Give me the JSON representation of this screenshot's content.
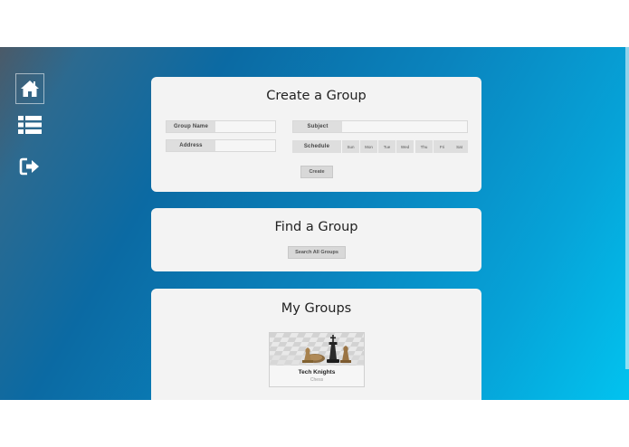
{
  "nav": {
    "items": [
      {
        "name": "home",
        "icon": "home-icon",
        "active": true
      },
      {
        "name": "list",
        "icon": "list-icon",
        "active": false
      },
      {
        "name": "logout",
        "icon": "sign-out-icon",
        "active": false
      }
    ]
  },
  "create_group": {
    "title": "Create a Group",
    "group_name_label": "Group Name",
    "group_name_value": "",
    "address_label": "Address",
    "address_value": "",
    "subject_label": "Subject",
    "subject_value": "",
    "schedule_label": "Schedule",
    "days": [
      "Sun",
      "Mon",
      "Tue",
      "Wed",
      "Thu",
      "Fri",
      "Sat"
    ],
    "create_label": "Create"
  },
  "find_group": {
    "title": "Find a Group",
    "search_all_label": "Search All Groups"
  },
  "my_groups": {
    "title": "My Groups",
    "groups": [
      {
        "name": "Tech Knights",
        "subject": "Chess",
        "image": "chess-pieces-image"
      }
    ]
  },
  "colors": {
    "card_bg": "#f3f3f3",
    "label_bg": "#dedede",
    "gradient_start": "#4b5a68",
    "gradient_end": "#02c3ef"
  }
}
